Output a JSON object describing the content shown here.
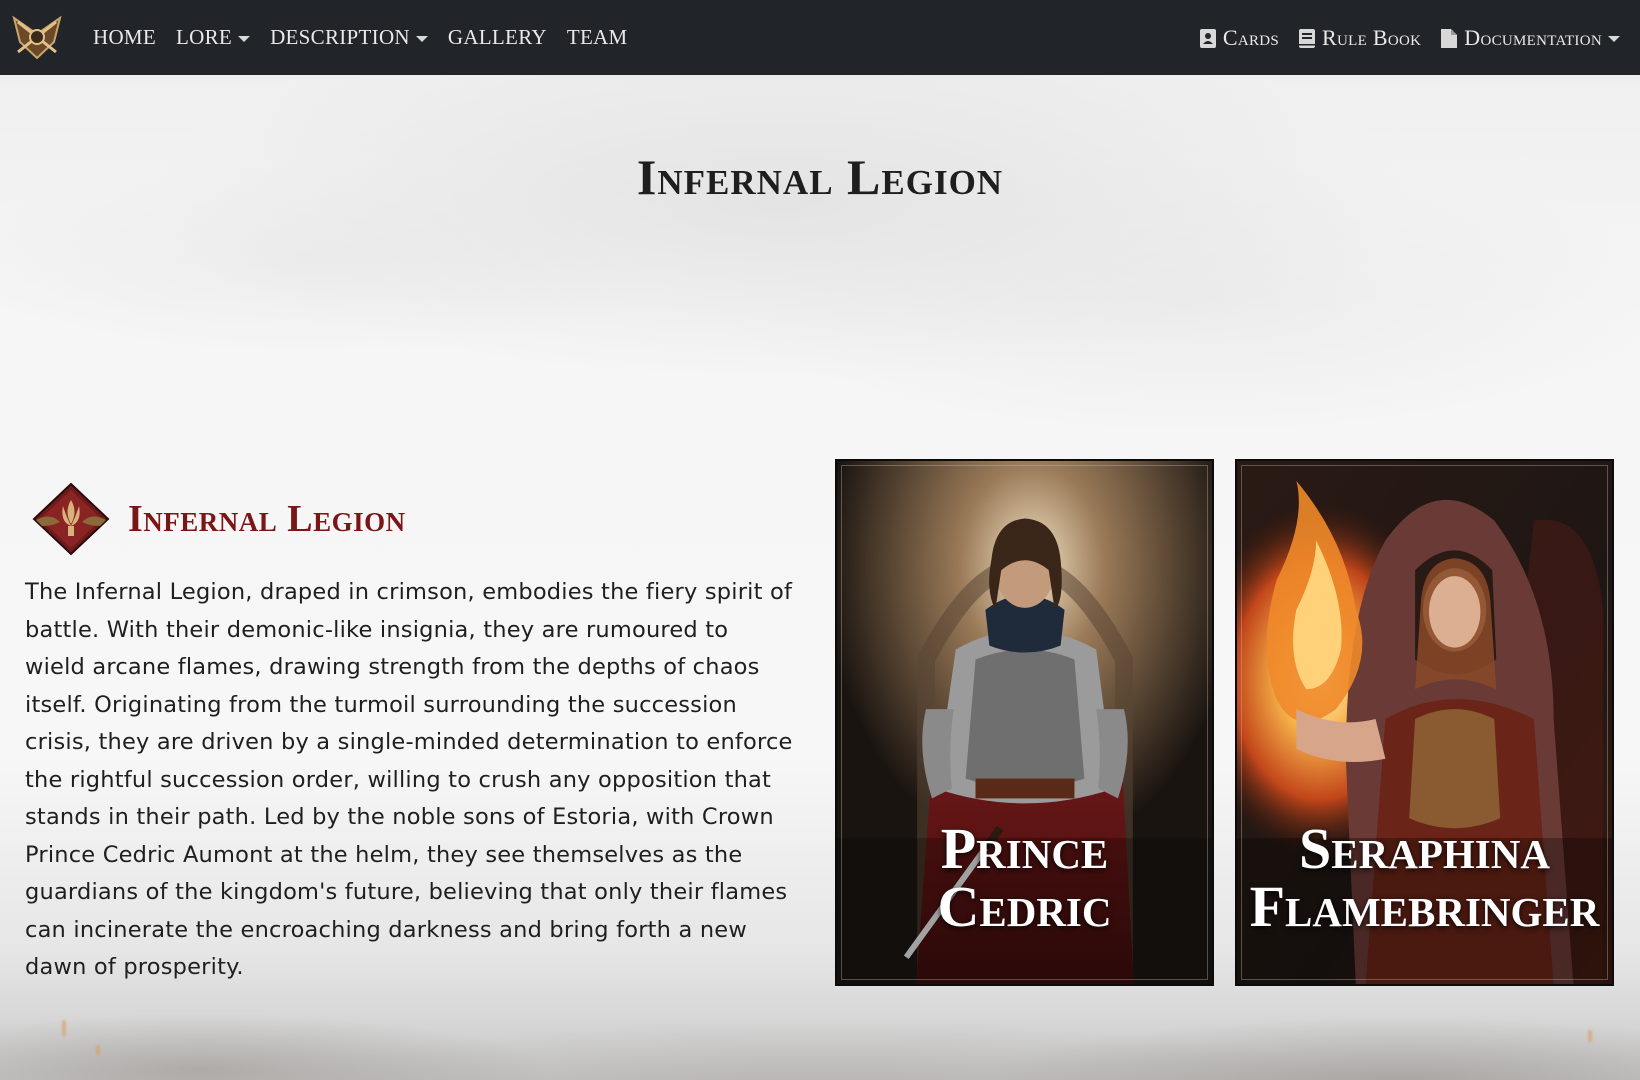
{
  "nav": {
    "left": [
      {
        "label": "HOME",
        "dropdown": false
      },
      {
        "label": "LORE",
        "dropdown": true
      },
      {
        "label": "DESCRIPTION",
        "dropdown": true
      },
      {
        "label": "GALLERY",
        "dropdown": false
      },
      {
        "label": "TEAM",
        "dropdown": false
      }
    ],
    "right": [
      {
        "label": "Cards",
        "icon": "contact-card-icon",
        "dropdown": false
      },
      {
        "label": "Rule Book",
        "icon": "book-icon",
        "dropdown": false
      },
      {
        "label": "Documentation",
        "icon": "file-icon",
        "dropdown": true
      }
    ]
  },
  "page": {
    "title": "Infernal Legion"
  },
  "faction": {
    "name": "Infernal Legion",
    "emblem_icon": "infernal-legion-emblem-icon",
    "description": "The Infernal Legion, draped in crimson, embodies the fiery spirit of battle. With their demonic-like insignia, they are rumoured to wield arcane flames, drawing strength from the depths of chaos itself. Originating from the turmoil surrounding the succession crisis, they are driven by a single-minded determination to enforce the rightful succession order, willing to crush any opposition that stands in their path. Led by the noble sons of Estoria, with Crown Prince Cedric Aumont at the helm, they see themselves as the guardians of the kingdom's future, believing that only their flames can incinerate the encroaching darkness and bring forth a new dawn of prosperity."
  },
  "cards": [
    {
      "line1": "Prince",
      "line2": "Cedric"
    },
    {
      "line1": "Seraphina",
      "line2": "Flamebringer"
    }
  ],
  "colors": {
    "navbar": "#212529",
    "faction_accent": "#7a1616"
  }
}
